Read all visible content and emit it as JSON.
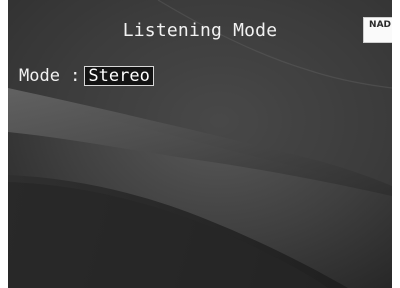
{
  "screen": {
    "title": "Listening Mode",
    "brand_logo_text": "NAD",
    "mode_label": "Mode :",
    "mode_value": "Stereo"
  }
}
